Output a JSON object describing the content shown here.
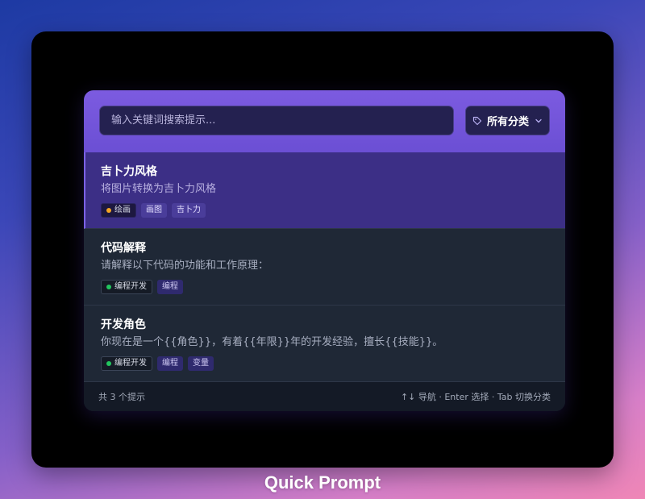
{
  "search": {
    "placeholder": "输入关键词搜索提示..."
  },
  "category_filter": {
    "selected": "所有分类",
    "icon": "tag-icon"
  },
  "prompts": [
    {
      "title": "吉卜力风格",
      "description": "将图片转换为吉卜力风格",
      "category": {
        "label": "绘画",
        "color": "#f5a623"
      },
      "tags": [
        "画图",
        "吉卜力"
      ],
      "selected": true
    },
    {
      "title": "代码解释",
      "description": "请解释以下代码的功能和工作原理：",
      "category": {
        "label": "编程开发",
        "color": "#22c55e"
      },
      "tags": [
        "编程"
      ],
      "selected": false
    },
    {
      "title": "开发角色",
      "description": "你现在是一个{{角色}}，有着{{年限}}年的开发经验，擅长{{技能}}。",
      "category": {
        "label": "编程开发",
        "color": "#22c55e"
      },
      "tags": [
        "编程",
        "变量"
      ],
      "selected": false
    }
  ],
  "footer": {
    "count_text": "共 3 个提示",
    "hint_text": "↑↓ 导航 · Enter 选择 · Tab 切换分类"
  },
  "app_title": "Quick Prompt"
}
